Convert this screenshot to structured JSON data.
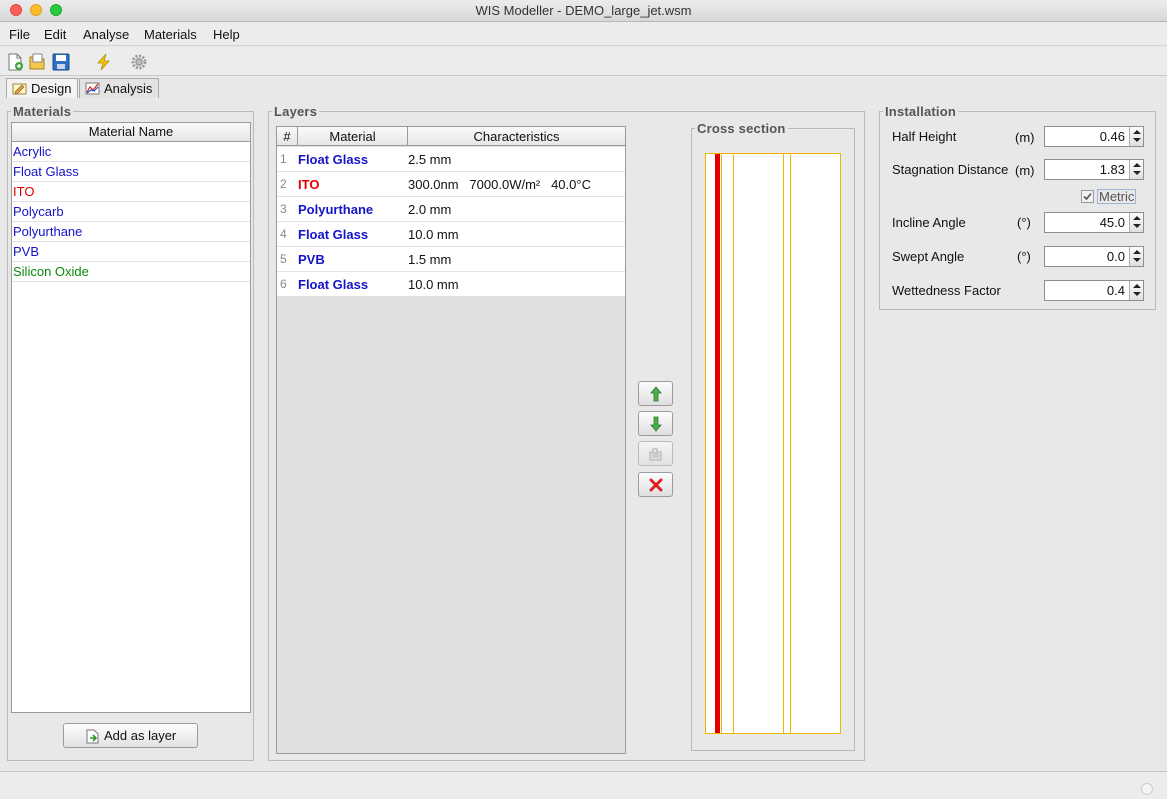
{
  "window": {
    "title": "WIS Modeller  -  DEMO_large_jet.wsm"
  },
  "menu": {
    "items": [
      "File",
      "Edit",
      "Analyse",
      "Materials",
      "Help"
    ]
  },
  "toolbar": {
    "icons": [
      "new-file-icon",
      "open-file-icon",
      "save-icon",
      "lightning-icon",
      "gear-icon"
    ]
  },
  "tabs": [
    {
      "label": "Design",
      "icon": "design-icon",
      "active": true
    },
    {
      "label": "Analysis",
      "icon": "analysis-chart-icon",
      "active": false
    }
  ],
  "materials": {
    "legend": "Materials",
    "column_header": "Material Name",
    "items": [
      {
        "name": "Acrylic",
        "color": "#1414c8"
      },
      {
        "name": "Float Glass",
        "color": "#1414c8"
      },
      {
        "name": "ITO",
        "color": "#e00000"
      },
      {
        "name": "Polycarb",
        "color": "#1414c8"
      },
      {
        "name": "Polyurthane",
        "color": "#1414c8"
      },
      {
        "name": "PVB",
        "color": "#1414c8"
      },
      {
        "name": "Silicon Oxide",
        "color": "#0a8a0a"
      }
    ],
    "add_button": "Add as layer"
  },
  "layers": {
    "legend": "Layers",
    "headers": {
      "num": "#",
      "material": "Material",
      "characteristics": "Characteristics"
    },
    "rows": [
      {
        "num": "1",
        "material": "Float Glass",
        "color": "#1414c8",
        "characteristics": "2.5 mm"
      },
      {
        "num": "2",
        "material": "ITO",
        "color": "#e00000",
        "characteristics": "300.0nm   7000.0W/m²   40.0°C"
      },
      {
        "num": "3",
        "material": "Polyurthane",
        "color": "#1414c8",
        "characteristics": "2.0 mm"
      },
      {
        "num": "4",
        "material": "Float Glass",
        "color": "#1414c8",
        "characteristics": "10.0 mm"
      },
      {
        "num": "5",
        "material": "PVB",
        "color": "#1414c8",
        "characteristics": "1.5 mm"
      },
      {
        "num": "6",
        "material": "Float Glass",
        "color": "#1414c8",
        "characteristics": "10.0 mm"
      }
    ],
    "side_buttons": [
      "move-up-arrow-icon",
      "move-down-arrow-icon",
      "duplicate-layer-icon",
      "delete-layer-icon"
    ]
  },
  "cross_section": {
    "legend": "Cross section",
    "layer_color": "#f0b400",
    "heater_color": "#e00000"
  },
  "installation": {
    "legend": "Installation",
    "fields": [
      {
        "label": "Half Height",
        "unit": "(m)",
        "value": "0.46"
      },
      {
        "label": "Stagnation Distance",
        "unit": "(m)",
        "value": "1.83"
      },
      {
        "label": "Incline Angle",
        "unit": "(°)",
        "value": "45.0"
      },
      {
        "label": "Swept Angle",
        "unit": "(°)",
        "value": "0.0"
      },
      {
        "label": "Wettedness Factor",
        "unit": "",
        "value": "0.4"
      }
    ],
    "metric_label": "Metric",
    "metric_checked": true
  }
}
